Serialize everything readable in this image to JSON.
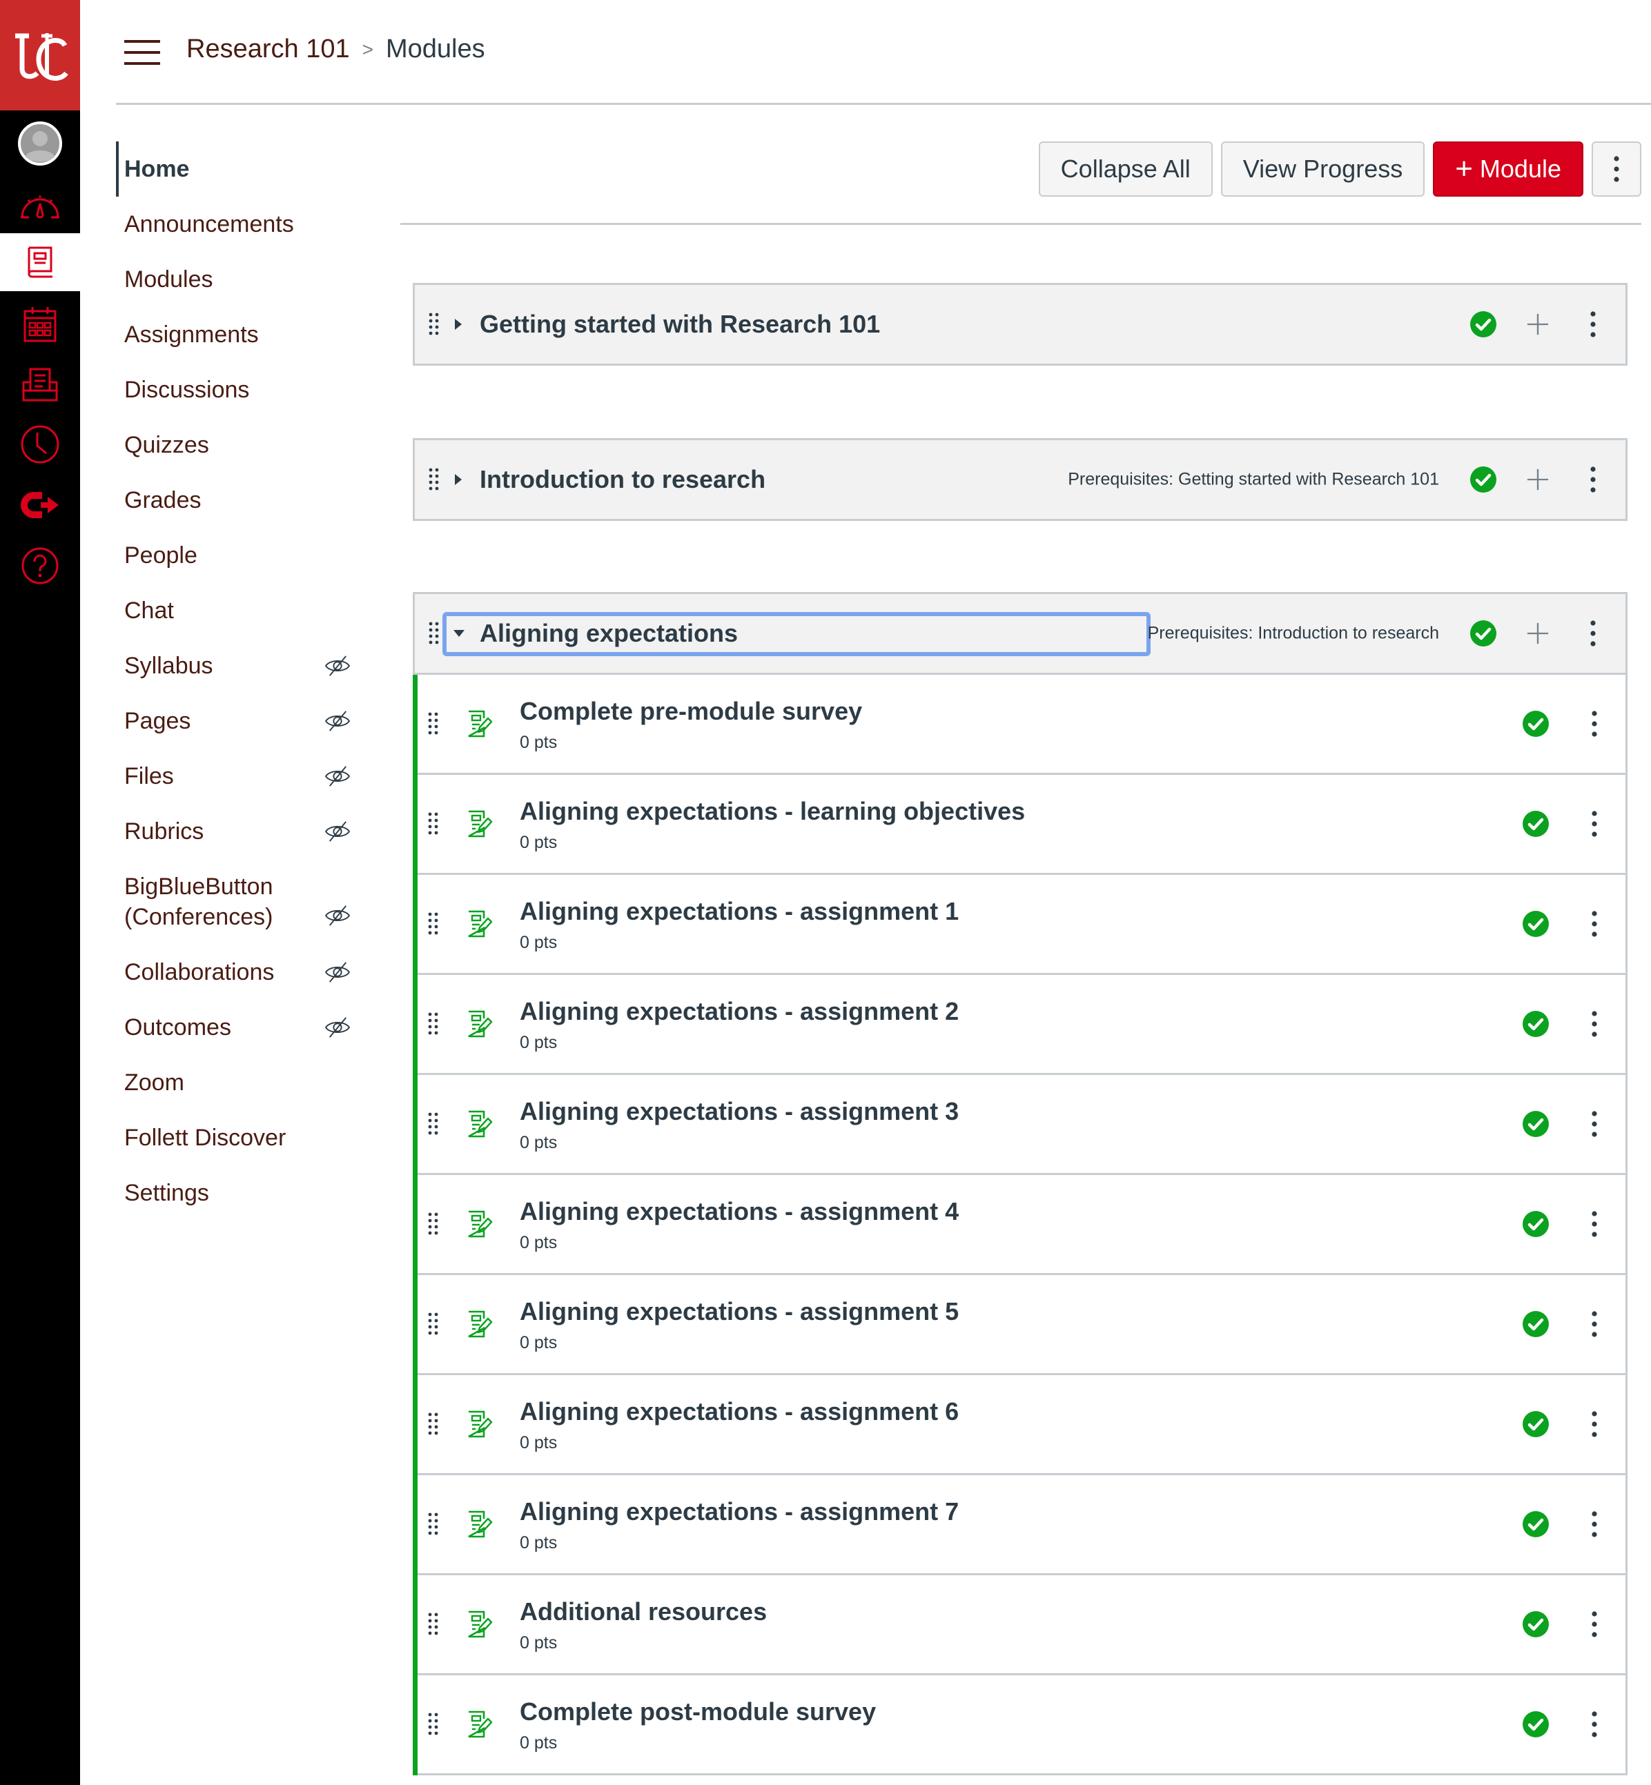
{
  "header": {
    "breadcrumb": {
      "course": "Research 101",
      "separator": ">",
      "current": "Modules"
    }
  },
  "global_nav": {
    "logo": "UC",
    "items": [
      {
        "icon": "account-avatar-icon",
        "label": "Account"
      },
      {
        "icon": "dashboard-icon",
        "label": "Dashboard"
      },
      {
        "icon": "courses-icon",
        "label": "Courses",
        "active": true
      },
      {
        "icon": "calendar-icon",
        "label": "Calendar"
      },
      {
        "icon": "inbox-icon",
        "label": "Inbox"
      },
      {
        "icon": "history-icon",
        "label": "History"
      },
      {
        "icon": "commons-icon",
        "label": "Commons"
      },
      {
        "icon": "help-icon",
        "label": "Help"
      }
    ]
  },
  "course_nav": {
    "items": [
      {
        "label": "Home",
        "active": true,
        "hidden": false
      },
      {
        "label": "Announcements",
        "hidden": false
      },
      {
        "label": "Modules",
        "hidden": false
      },
      {
        "label": "Assignments",
        "hidden": false
      },
      {
        "label": "Discussions",
        "hidden": false
      },
      {
        "label": "Quizzes",
        "hidden": false
      },
      {
        "label": "Grades",
        "hidden": false
      },
      {
        "label": "People",
        "hidden": false
      },
      {
        "label": "Chat",
        "hidden": false
      },
      {
        "label": "Syllabus",
        "hidden": true
      },
      {
        "label": "Pages",
        "hidden": true
      },
      {
        "label": "Files",
        "hidden": true
      },
      {
        "label": "Rubrics",
        "hidden": true
      },
      {
        "label": "BigBlueButton (Conferences)",
        "line1": "BigBlueButton",
        "line2": "(Conferences)",
        "hidden": true
      },
      {
        "label": "Collaborations",
        "hidden": true
      },
      {
        "label": "Outcomes",
        "hidden": true
      },
      {
        "label": "Zoom",
        "hidden": false
      },
      {
        "label": "Follett Discover",
        "hidden": false
      },
      {
        "label": "Settings",
        "hidden": false
      }
    ]
  },
  "toolbar": {
    "collapse_all": "Collapse All",
    "view_progress": "View Progress",
    "add_module_plus": "+",
    "add_module": "Module"
  },
  "colors": {
    "brand_red": "#cb2a2a",
    "primary_button": "#d9001b",
    "published_green": "#0ba21f",
    "focus_ring": "#7aa5ee",
    "nav_text": "#4a1c13",
    "text": "#2d3b45"
  },
  "modules": [
    {
      "title": "Getting started with Research 101",
      "expanded": false,
      "prerequisites": "",
      "published": true
    },
    {
      "title": "Introduction to research",
      "expanded": false,
      "prerequisites": "Prerequisites: Getting started with Research 101",
      "published": true
    },
    {
      "title": "Aligning expectations",
      "expanded": true,
      "focused": true,
      "prerequisites": "Prerequisites: Introduction to research",
      "published": true,
      "items": [
        {
          "title": "Complete pre-module survey",
          "points": "0 pts",
          "type": "assignment",
          "published": true
        },
        {
          "title": "Aligning expectations - learning objectives",
          "points": "0 pts",
          "type": "assignment",
          "published": true
        },
        {
          "title": "Aligning expectations - assignment 1",
          "points": "0 pts",
          "type": "assignment",
          "published": true
        },
        {
          "title": "Aligning expectations - assignment 2",
          "points": "0 pts",
          "type": "assignment",
          "published": true
        },
        {
          "title": "Aligning expectations - assignment 3",
          "points": "0 pts",
          "type": "assignment",
          "published": true
        },
        {
          "title": "Aligning expectations - assignment 4",
          "points": "0 pts",
          "type": "assignment",
          "published": true
        },
        {
          "title": "Aligning expectations - assignment 5",
          "points": "0 pts",
          "type": "assignment",
          "published": true
        },
        {
          "title": "Aligning expectations - assignment 6",
          "points": "0 pts",
          "type": "assignment",
          "published": true
        },
        {
          "title": "Aligning expectations - assignment 7",
          "points": "0 pts",
          "type": "assignment",
          "published": true
        },
        {
          "title": "Additional resources",
          "points": "0 pts",
          "type": "assignment",
          "published": true
        },
        {
          "title": "Complete post-module survey",
          "points": "0 pts",
          "type": "assignment",
          "published": true
        }
      ]
    }
  ]
}
